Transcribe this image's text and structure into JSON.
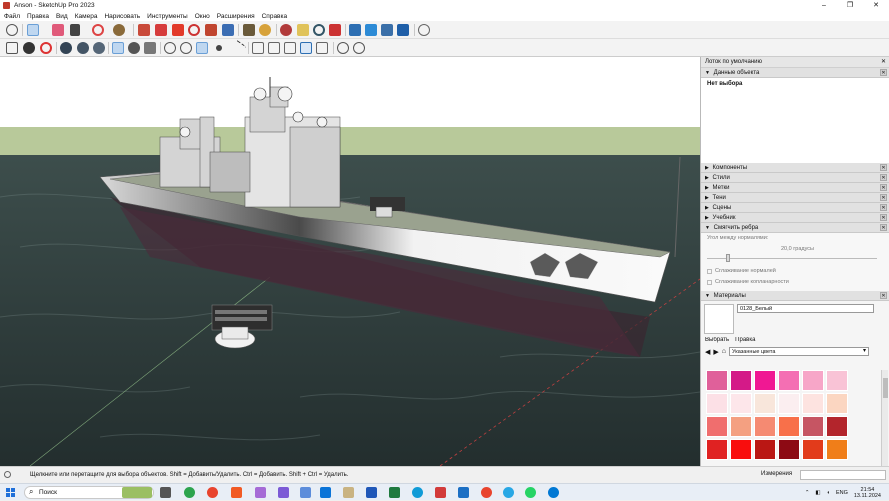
{
  "window": {
    "title": "Anson - SketchUp Pro 2023",
    "controls": [
      "–",
      "❐",
      "✕"
    ]
  },
  "menu": [
    "Файл",
    "Правка",
    "Вид",
    "Камера",
    "Нарисовать",
    "Инструменты",
    "Окно",
    "Расширения",
    "Справка"
  ],
  "colors": {
    "sky": "#ffffff",
    "ground": "#b8c99a",
    "water": "#2e3e3c",
    "hull": "#f3f3f3",
    "hull_shadow": "#3a2630"
  },
  "tray": {
    "title": "Лоток по умолчанию",
    "entity_section": "Данные объекта",
    "entity_text": "Нет выбора",
    "sections": [
      "Компоненты",
      "Стили",
      "Метки",
      "Тени",
      "Сцены",
      "Учебник",
      "Смягчить ребра"
    ],
    "soften": {
      "angle_label": "Угол между нормалями:",
      "angle_value": "20,0",
      "angle_unit": "градусы",
      "cb_normals": "Сглаживание нормалей",
      "cb_coplanar": "Сглаживание копланарности"
    },
    "materials": {
      "header": "Материалы",
      "name": "0128_Белый",
      "tab_select": "Выбрать",
      "tab_edit": "Правка",
      "collection": "Указанные цвета",
      "swatches": [
        "#e0609a",
        "#d41a88",
        "#f01893",
        "#f46fb3",
        "#f7a6c8",
        "#f9c3d6",
        "#fce0e6",
        "#fde6ea",
        "#f8e6db",
        "#fbeef0",
        "#fde3e0",
        "#fbd6c1",
        "#f06e6e",
        "#f4a081",
        "#f58a72",
        "#f8704a",
        "#c65563",
        "#b3252c",
        "#e02222",
        "#f90d0d",
        "#ba1714",
        "#8d0a14",
        "#e23b1b",
        "#f07e19",
        "#f7a94b",
        "#f9c77f",
        "#f9d9a5",
        "#f7e6c8"
      ]
    }
  },
  "status": {
    "text": "Щелкните или перетащите для выбора объектов. Shift = Добавить/Удалить. Ctrl = Добавить. Shift + Ctrl = Удалить.",
    "measure_label": "Измерения"
  },
  "taskbar": {
    "search": "Поиск",
    "lang": "ENG",
    "time": "21:54",
    "date": "13.11.2024"
  }
}
